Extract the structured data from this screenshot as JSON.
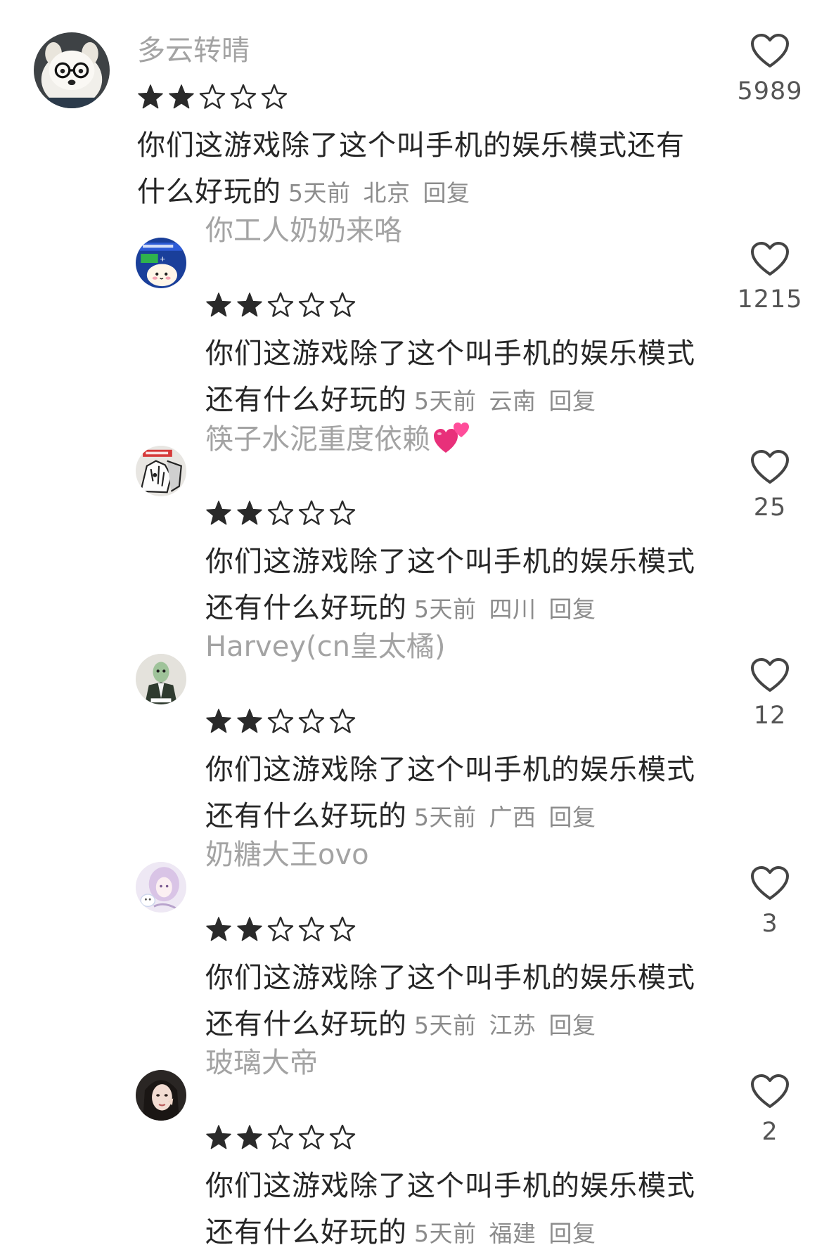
{
  "colors": {
    "username": "#a3a3a3",
    "text": "#262626",
    "meta": "#8c8c8c",
    "star": "#2a2a2a",
    "heart": "#444444",
    "count": "#555555"
  },
  "comments": [
    {
      "username": "多云转晴",
      "rating": 2,
      "rating_max": 5,
      "text_line1": "你们这游戏除了这个叫手机的娱乐模式还有",
      "text_line2": "什么好玩的",
      "time": "5天前",
      "location": "北京",
      "reply": "回复",
      "likes": "5989",
      "avatar": "samoyed-with-glasses-avatar"
    },
    {
      "username": "你工人奶奶来咯",
      "rating": 2,
      "rating_max": 5,
      "text_line1": "你们这游戏除了这个叫手机的娱乐模式",
      "text_line2": "还有什么好玩的",
      "time": "5天前",
      "location": "云南",
      "reply": "回复",
      "likes": "1215",
      "avatar": "cartoon-poster-avatar"
    },
    {
      "username": "筷子水泥重度依赖",
      "rating": 2,
      "rating_max": 5,
      "text_line1": "你们这游戏除了这个叫手机的娱乐模式",
      "text_line2": "还有什么好玩的",
      "time": "5天前",
      "location": "四川",
      "reply": "回复",
      "likes": "25",
      "avatar": "manga-sketch-avatar",
      "username_emoji": "two-hearts-emoji"
    },
    {
      "username": "Harvey(cn皇太橘)",
      "rating": 2,
      "rating_max": 5,
      "text_line1": "你们这游戏除了这个叫手机的娱乐模式",
      "text_line2": "还有什么好玩的",
      "time": "5天前",
      "location": "广西",
      "reply": "回复",
      "likes": "12",
      "avatar": "character-in-suit-avatar"
    },
    {
      "username": "奶糖大王ovo",
      "rating": 2,
      "rating_max": 5,
      "text_line1": "你们这游戏除了这个叫手机的娱乐模式",
      "text_line2": "还有什么好玩的",
      "time": "5天前",
      "location": "江苏",
      "reply": "回复",
      "likes": "3",
      "avatar": "anime-girl-avatar"
    },
    {
      "username": "玻璃大帝",
      "rating": 2,
      "rating_max": 5,
      "text_line1": "你们这游戏除了这个叫手机的娱乐模式",
      "text_line2": "还有什么好玩的",
      "time": "5天前",
      "location": "福建",
      "reply": "回复",
      "likes": "2",
      "avatar": "girl-portrait-avatar"
    }
  ]
}
